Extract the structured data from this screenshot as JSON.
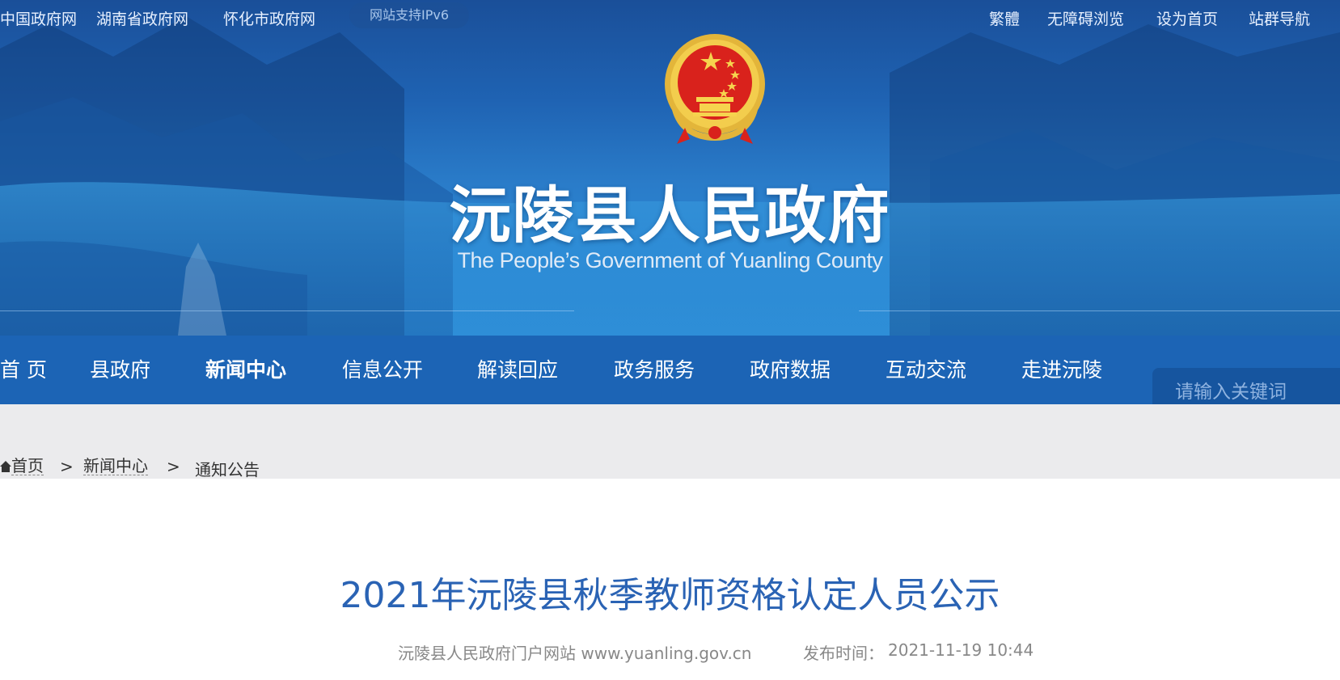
{
  "topbar": {
    "left_links": [
      "中国政府网",
      "湖南省政府网",
      "怀化市政府网"
    ],
    "ipv6_badge": "网站支持IPv6",
    "right_links": [
      "繁體",
      "无障碍浏览",
      "设为首页",
      "站群导航"
    ]
  },
  "header": {
    "title": "沅陵县人民政府",
    "subtitle": "The People’s Government of Yuanling County",
    "emblem": "national-emblem"
  },
  "nav": {
    "items": [
      "首 页",
      "县政府",
      "新闻中心",
      "信息公开",
      "解读回应",
      "政务服务",
      "政府数据",
      "互动交流",
      "走进沅陵"
    ],
    "active": "新闻中心",
    "search_placeholder": "请输入关键词"
  },
  "breadcrumb": {
    "home_icon": "home-icon",
    "items": [
      "首页",
      "新闻中心",
      "通知公告"
    ],
    "separator": ">"
  },
  "article": {
    "title": "2021年沅陵县秋季教师资格认定人员公示",
    "source": "沅陵县人民政府门户网站 www.yuanling.gov.cn",
    "publish_label": "发布时间：",
    "publish_time": "2021-11-19 10:44"
  },
  "colors": {
    "nav_bg": "#1c64b5",
    "title_blue": "#2a63b4",
    "crumb_bg": "#ebebed"
  }
}
